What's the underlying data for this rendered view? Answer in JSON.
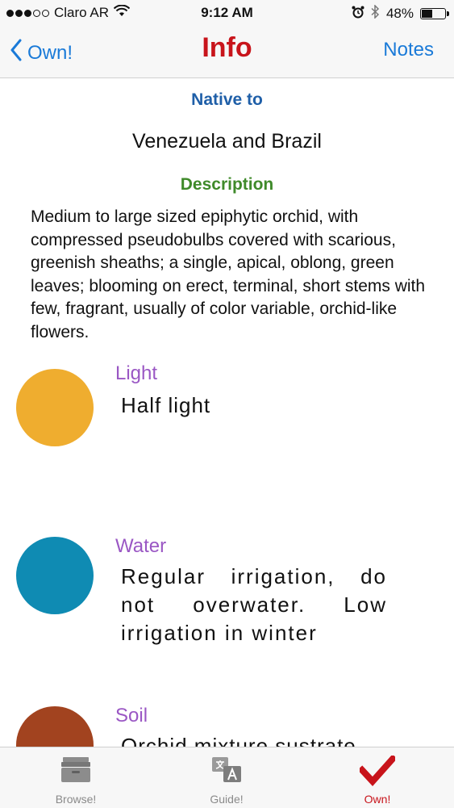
{
  "status_bar": {
    "carrier": "Claro AR",
    "time": "9:12 AM",
    "battery_percent": "48%",
    "battery_level": 0.48,
    "signal_bars": 3,
    "signal_total": 5
  },
  "nav": {
    "back_label": "Own!",
    "title": "Info",
    "right_label": "Notes",
    "title_color": "#c8141b",
    "link_color": "#1a7ad8"
  },
  "native": {
    "heading": "Native to",
    "value": "Venezuela and Brazil"
  },
  "description": {
    "heading": "Description",
    "text": "Medium to large sized epiphytic orchid, with compressed pseudobulbs covered with scarious, greenish sheaths; a single, apical, oblong, green leaves; blooming on erect, terminal, short stems with few, fragrant, usually of color variable, orchid-like flowers."
  },
  "care": [
    {
      "label": "Light",
      "value": "Half light",
      "color": "#efad2f"
    },
    {
      "label": "Water",
      "value": "Regular irrigation, do not overwater. Low irrigation in winter",
      "color": "#0f8bb3"
    },
    {
      "label": "Soil",
      "value": "Orchid mixture sustrate",
      "color": "#a2431f"
    }
  ],
  "tabs": [
    {
      "label": "Browse!",
      "icon": "browse-box-icon"
    },
    {
      "label": "Guide!",
      "icon": "translate-icon"
    },
    {
      "label": "Own!",
      "icon": "checkmark-icon",
      "active": true
    }
  ]
}
